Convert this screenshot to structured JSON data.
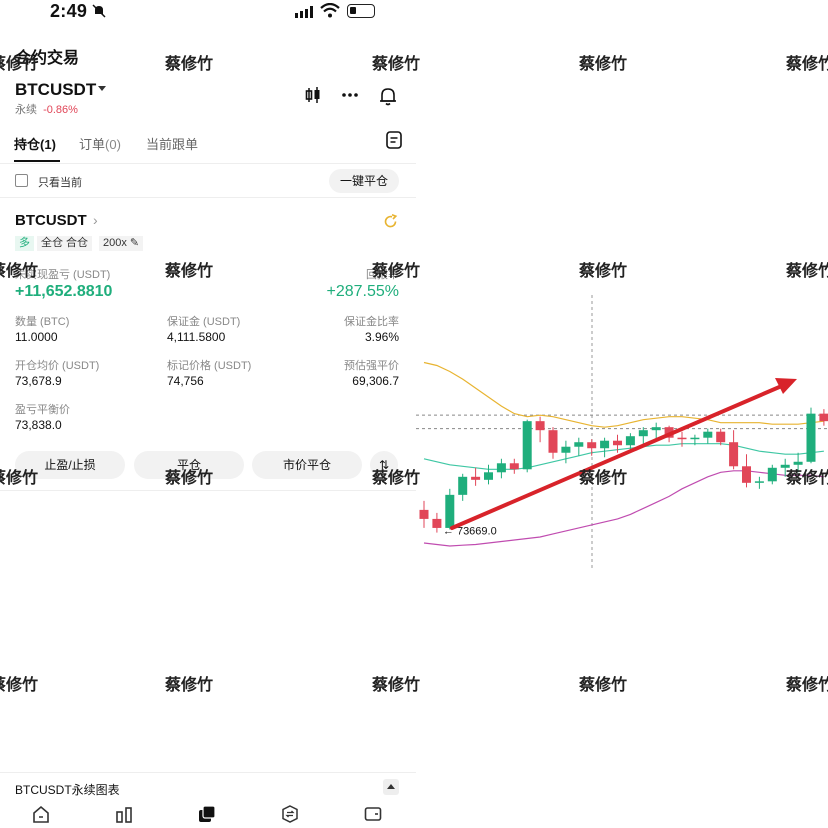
{
  "status_bar": {
    "time": "2:49",
    "battery_level": 0.25
  },
  "header": {
    "page_title": "合约交易",
    "symbol": "BTCUSDT",
    "perp_label": "永续",
    "change_pct": "-0.86%"
  },
  "tabs": [
    {
      "label": "持仓",
      "count": "(1)",
      "active": true
    },
    {
      "label": "订单",
      "count": "(0)",
      "active": false
    },
    {
      "label": "当前跟单",
      "count": "",
      "active": false
    }
  ],
  "filter": {
    "only_current_label": "只看当前",
    "close_all_label": "一键平仓"
  },
  "position": {
    "symbol": "BTCUSDT",
    "side_tag": "多",
    "margin_mode": "全仓 合仓",
    "leverage": "200x",
    "unrealized_pnl_label": "未实现盈亏 (USDT)",
    "unrealized_pnl_value": "+11,652.8810",
    "roe_label": "回报率",
    "roe_value": "+287.55%",
    "quantity_label": "数量 (BTC)",
    "quantity_value": "11.0000",
    "margin_label": "保证金 (USDT)",
    "margin_value": "4,111.5800",
    "margin_ratio_label": "保证金比率",
    "margin_ratio_value": "3.96%",
    "entry_price_label": "开仓均价 (USDT)",
    "entry_price_value": "73,678.9",
    "mark_price_label": "标记价格 (USDT)",
    "mark_price_value": "74,756",
    "liq_price_label": "预估强平价",
    "liq_price_value": "69,306.7",
    "breakeven_label": "盈亏平衡价",
    "breakeven_value": "73,838.0"
  },
  "actions": {
    "tp_sl": "止盈/止损",
    "close": "平仓",
    "market_close": "市价平仓"
  },
  "bottom_bar": {
    "chart_label": "BTCUSDT永续图表"
  },
  "watermark": {
    "text": "蔡修竹"
  },
  "colors": {
    "up": "#1fae7c",
    "down": "#e14658",
    "arrow": "#d8232a",
    "upper_band": "#e8b431",
    "mid_band": "#3fc7a4",
    "lower_band": "#c04cb0"
  },
  "chart_data": {
    "type": "candlestick",
    "annotation_low": "73669.0",
    "candles": [
      {
        "o": 73820,
        "h": 73880,
        "l": 73700,
        "c": 73760
      },
      {
        "o": 73760,
        "h": 73800,
        "l": 73669,
        "c": 73700
      },
      {
        "o": 73700,
        "h": 73960,
        "l": 73690,
        "c": 73920
      },
      {
        "o": 73920,
        "h": 74060,
        "l": 73880,
        "c": 74040
      },
      {
        "o": 74040,
        "h": 74100,
        "l": 73980,
        "c": 74020
      },
      {
        "o": 74020,
        "h": 74120,
        "l": 73990,
        "c": 74070
      },
      {
        "o": 74070,
        "h": 74160,
        "l": 74030,
        "c": 74130
      },
      {
        "o": 74130,
        "h": 74160,
        "l": 74060,
        "c": 74090
      },
      {
        "o": 74090,
        "h": 74420,
        "l": 74070,
        "c": 74410
      },
      {
        "o": 74410,
        "h": 74440,
        "l": 74270,
        "c": 74350
      },
      {
        "o": 74350,
        "h": 74370,
        "l": 74160,
        "c": 74200
      },
      {
        "o": 74200,
        "h": 74280,
        "l": 74130,
        "c": 74240
      },
      {
        "o": 74240,
        "h": 74300,
        "l": 74180,
        "c": 74270
      },
      {
        "o": 74270,
        "h": 74290,
        "l": 74180,
        "c": 74230
      },
      {
        "o": 74230,
        "h": 74300,
        "l": 74170,
        "c": 74280
      },
      {
        "o": 74280,
        "h": 74320,
        "l": 74200,
        "c": 74250
      },
      {
        "o": 74250,
        "h": 74330,
        "l": 74210,
        "c": 74310
      },
      {
        "o": 74310,
        "h": 74370,
        "l": 74260,
        "c": 74350
      },
      {
        "o": 74350,
        "h": 74400,
        "l": 74280,
        "c": 74370
      },
      {
        "o": 74370,
        "h": 74380,
        "l": 74270,
        "c": 74300
      },
      {
        "o": 74300,
        "h": 74340,
        "l": 74240,
        "c": 74290
      },
      {
        "o": 74290,
        "h": 74320,
        "l": 74250,
        "c": 74300
      },
      {
        "o": 74300,
        "h": 74360,
        "l": 74260,
        "c": 74340
      },
      {
        "o": 74340,
        "h": 74360,
        "l": 74250,
        "c": 74270
      },
      {
        "o": 74270,
        "h": 74350,
        "l": 74090,
        "c": 74110
      },
      {
        "o": 74110,
        "h": 74190,
        "l": 73970,
        "c": 74000
      },
      {
        "o": 74000,
        "h": 74040,
        "l": 73960,
        "c": 74010
      },
      {
        "o": 74010,
        "h": 74120,
        "l": 73990,
        "c": 74100
      },
      {
        "o": 74100,
        "h": 74160,
        "l": 74040,
        "c": 74120
      },
      {
        "o": 74120,
        "h": 74200,
        "l": 74070,
        "c": 74140
      },
      {
        "o": 74140,
        "h": 74500,
        "l": 74130,
        "c": 74460
      },
      {
        "o": 74460,
        "h": 74490,
        "l": 74380,
        "c": 74410
      }
    ],
    "upper_band": [
      74800,
      74780,
      74740,
      74690,
      74630,
      74570,
      74510,
      74460,
      74440,
      74450,
      74440,
      74420,
      74400,
      74380,
      74370,
      74380,
      74400,
      74420,
      74430,
      74440,
      74440,
      74430,
      74420,
      74400,
      74400,
      74400,
      74400,
      74390,
      74390,
      74390,
      74400,
      74410
    ],
    "mid_band": [
      74160,
      74140,
      74120,
      74110,
      74100,
      74090,
      74090,
      74090,
      74100,
      74120,
      74140,
      74160,
      74180,
      74200,
      74210,
      74220,
      74230,
      74240,
      74250,
      74250,
      74260,
      74260,
      74260,
      74260,
      74250,
      74230,
      74210,
      74200,
      74190,
      74190,
      74200,
      74210
    ],
    "lower_band": [
      73600,
      73590,
      73580,
      73585,
      73590,
      73600,
      73610,
      73620,
      73630,
      73640,
      73660,
      73680,
      73700,
      73720,
      73740,
      73760,
      73790,
      73830,
      73870,
      73910,
      73960,
      74000,
      74040,
      74070,
      74080,
      74080,
      74070,
      74060,
      74050,
      74050,
      74050,
      74040
    ],
    "reference_lines": [
      74450,
      74360
    ]
  }
}
